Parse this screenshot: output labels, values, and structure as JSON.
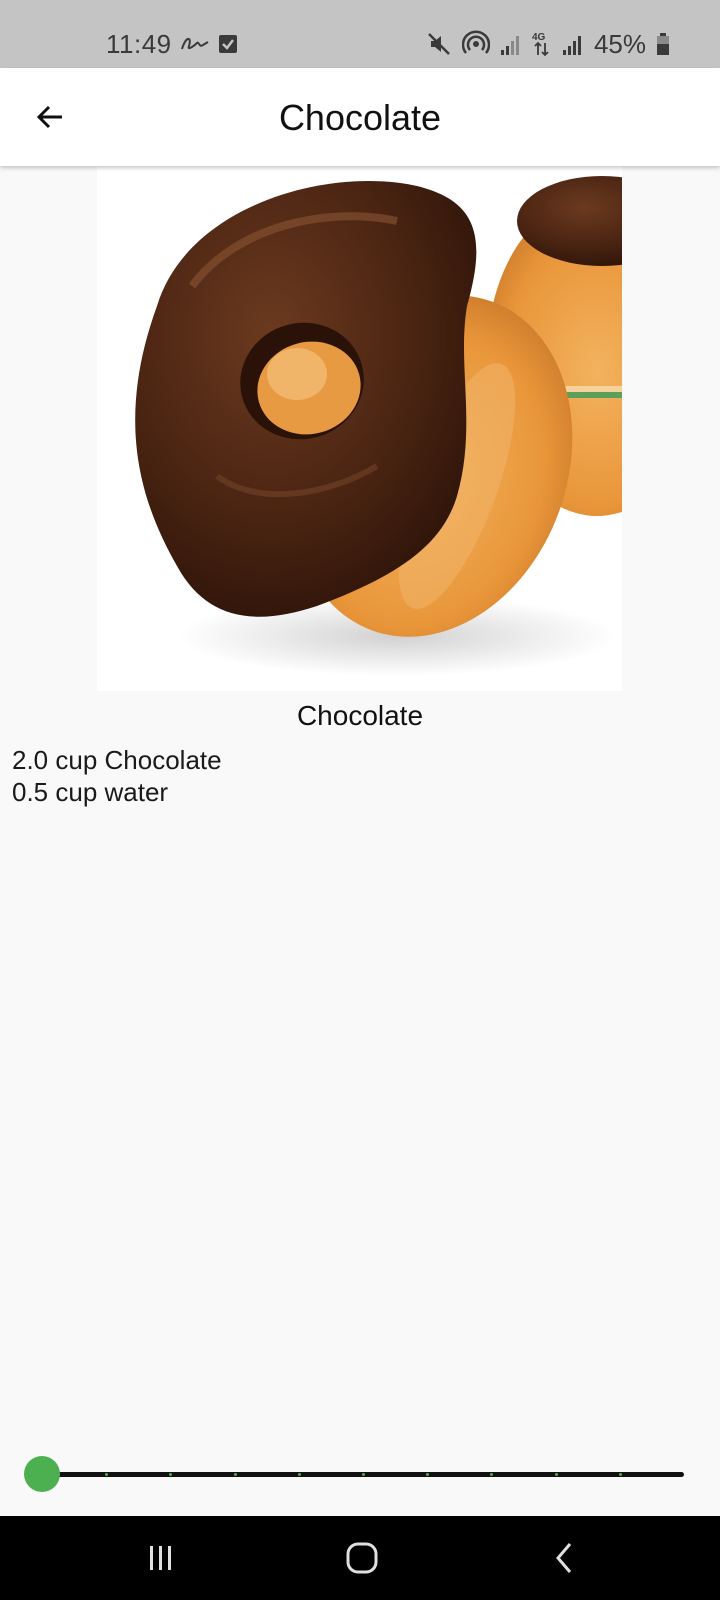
{
  "status_bar": {
    "time": "11:49",
    "battery_percent": "45%",
    "icons": [
      "signature-icon",
      "check-box-icon",
      "mute-icon",
      "hotspot-icon",
      "signal-icon",
      "4g-icon",
      "signal-icon",
      "battery-icon"
    ]
  },
  "app_bar": {
    "title": "Chocolate",
    "back_icon": "arrow-left-icon"
  },
  "recipe": {
    "image_description_name": "chocolate-donut-image",
    "caption": "Chocolate",
    "ingredients": [
      "2.0 cup Chocolate",
      "0.5 cup water"
    ]
  },
  "slider": {
    "value": 0,
    "min": 0,
    "max": 10,
    "divisions": 10,
    "accent_color": "#4caf50",
    "track_color": "#111111"
  },
  "nav_bar": {
    "recent_icon": "recent-apps-icon",
    "home_icon": "home-icon",
    "back_icon": "back-chevron-icon"
  },
  "colors": {
    "status_bar_bg": "#c4c4c4",
    "app_bar_bg": "#ffffff",
    "page_bg": "#f9f9f9",
    "nav_bar_bg": "#000000"
  }
}
